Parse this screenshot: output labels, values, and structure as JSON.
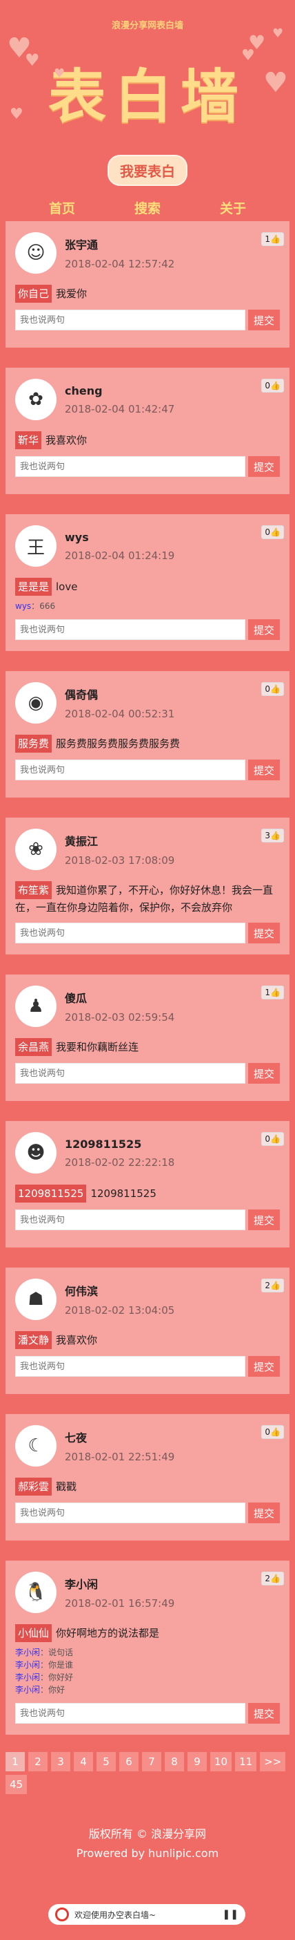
{
  "header": {
    "site_tag": "浪漫分享网表白墙",
    "title": "表白墙",
    "confess_button": "我要表白",
    "nav": [
      "首页",
      "搜索",
      "关于"
    ]
  },
  "reply": {
    "placeholder": "我也说两句",
    "button": "提交"
  },
  "posts": [
    {
      "name": "张宇通",
      "time": "2018-02-04 12:57:42",
      "likes": "1",
      "to": "你自己",
      "text": "我爱你",
      "comments": [],
      "avatar": "☺"
    },
    {
      "name": "cheng",
      "time": "2018-02-04 01:42:47",
      "likes": "0",
      "to": "靳华",
      "text": "我喜欢你",
      "comments": [],
      "avatar": "✿"
    },
    {
      "name": "wys",
      "time": "2018-02-04 01:24:19",
      "likes": "0",
      "to": "是是是",
      "text": "love",
      "comments": [
        {
          "n": "wys",
          "t": "666"
        }
      ],
      "avatar": "王"
    },
    {
      "name": "偶奇偶",
      "time": "2018-02-04 00:52:31",
      "likes": "0",
      "to": "服务费",
      "text": "服务费服务费服务费服务费",
      "comments": [],
      "avatar": "◉"
    },
    {
      "name": "黄振江",
      "time": "2018-02-03 17:08:09",
      "likes": "3",
      "to": "布笙紫",
      "text": "我知道你累了，不开心，你好好休息！我会一直在，一直在你身边陪着你，保护你，不会放弃你",
      "comments": [],
      "avatar": "❀"
    },
    {
      "name": "傻瓜",
      "time": "2018-02-03 02:59:54",
      "likes": "1",
      "to": "余昌燕",
      "text": "我要和你藕断丝连",
      "comments": [],
      "avatar": "♟"
    },
    {
      "name": "1209811525",
      "time": "2018-02-02 22:22:18",
      "likes": "0",
      "to": "1209811525",
      "text": "1209811525",
      "comments": [],
      "avatar": "☻"
    },
    {
      "name": "何伟滨",
      "time": "2018-02-02 13:04:05",
      "likes": "2",
      "to": "潘文静",
      "text": "我喜欢你",
      "comments": [],
      "avatar": "☗"
    },
    {
      "name": "七夜",
      "time": "2018-02-01 22:51:49",
      "likes": "0",
      "to": "郝彩雲",
      "text": "戳戳",
      "comments": [],
      "avatar": "☾"
    },
    {
      "name": "李小闲",
      "time": "2018-02-01 16:57:49",
      "likes": "2",
      "to": "小仙仙",
      "text": "你好啊地方的说法都是",
      "comments": [
        {
          "n": "李小闲",
          "t": "说句话"
        },
        {
          "n": "李小闲",
          "t": "你是谁"
        },
        {
          "n": "李小闲",
          "t": "你好好"
        },
        {
          "n": "李小闲",
          "t": "你好"
        }
      ],
      "avatar": "🐧"
    }
  ],
  "pager": [
    "1",
    "2",
    "3",
    "4",
    "5",
    "6",
    "7",
    "8",
    "9",
    "10",
    "11",
    ">>",
    "45"
  ],
  "footer": {
    "copyright": "版权所有 © 浪漫分享网",
    "powered": "Prowered by hunlipic.com"
  },
  "player": {
    "text": "欢迎使用办空表白墙~"
  },
  "colors": {
    "bg": "#f06a66",
    "card": "#f7a3a0",
    "accent": "#e2504d",
    "title": "#ffdc8a"
  }
}
